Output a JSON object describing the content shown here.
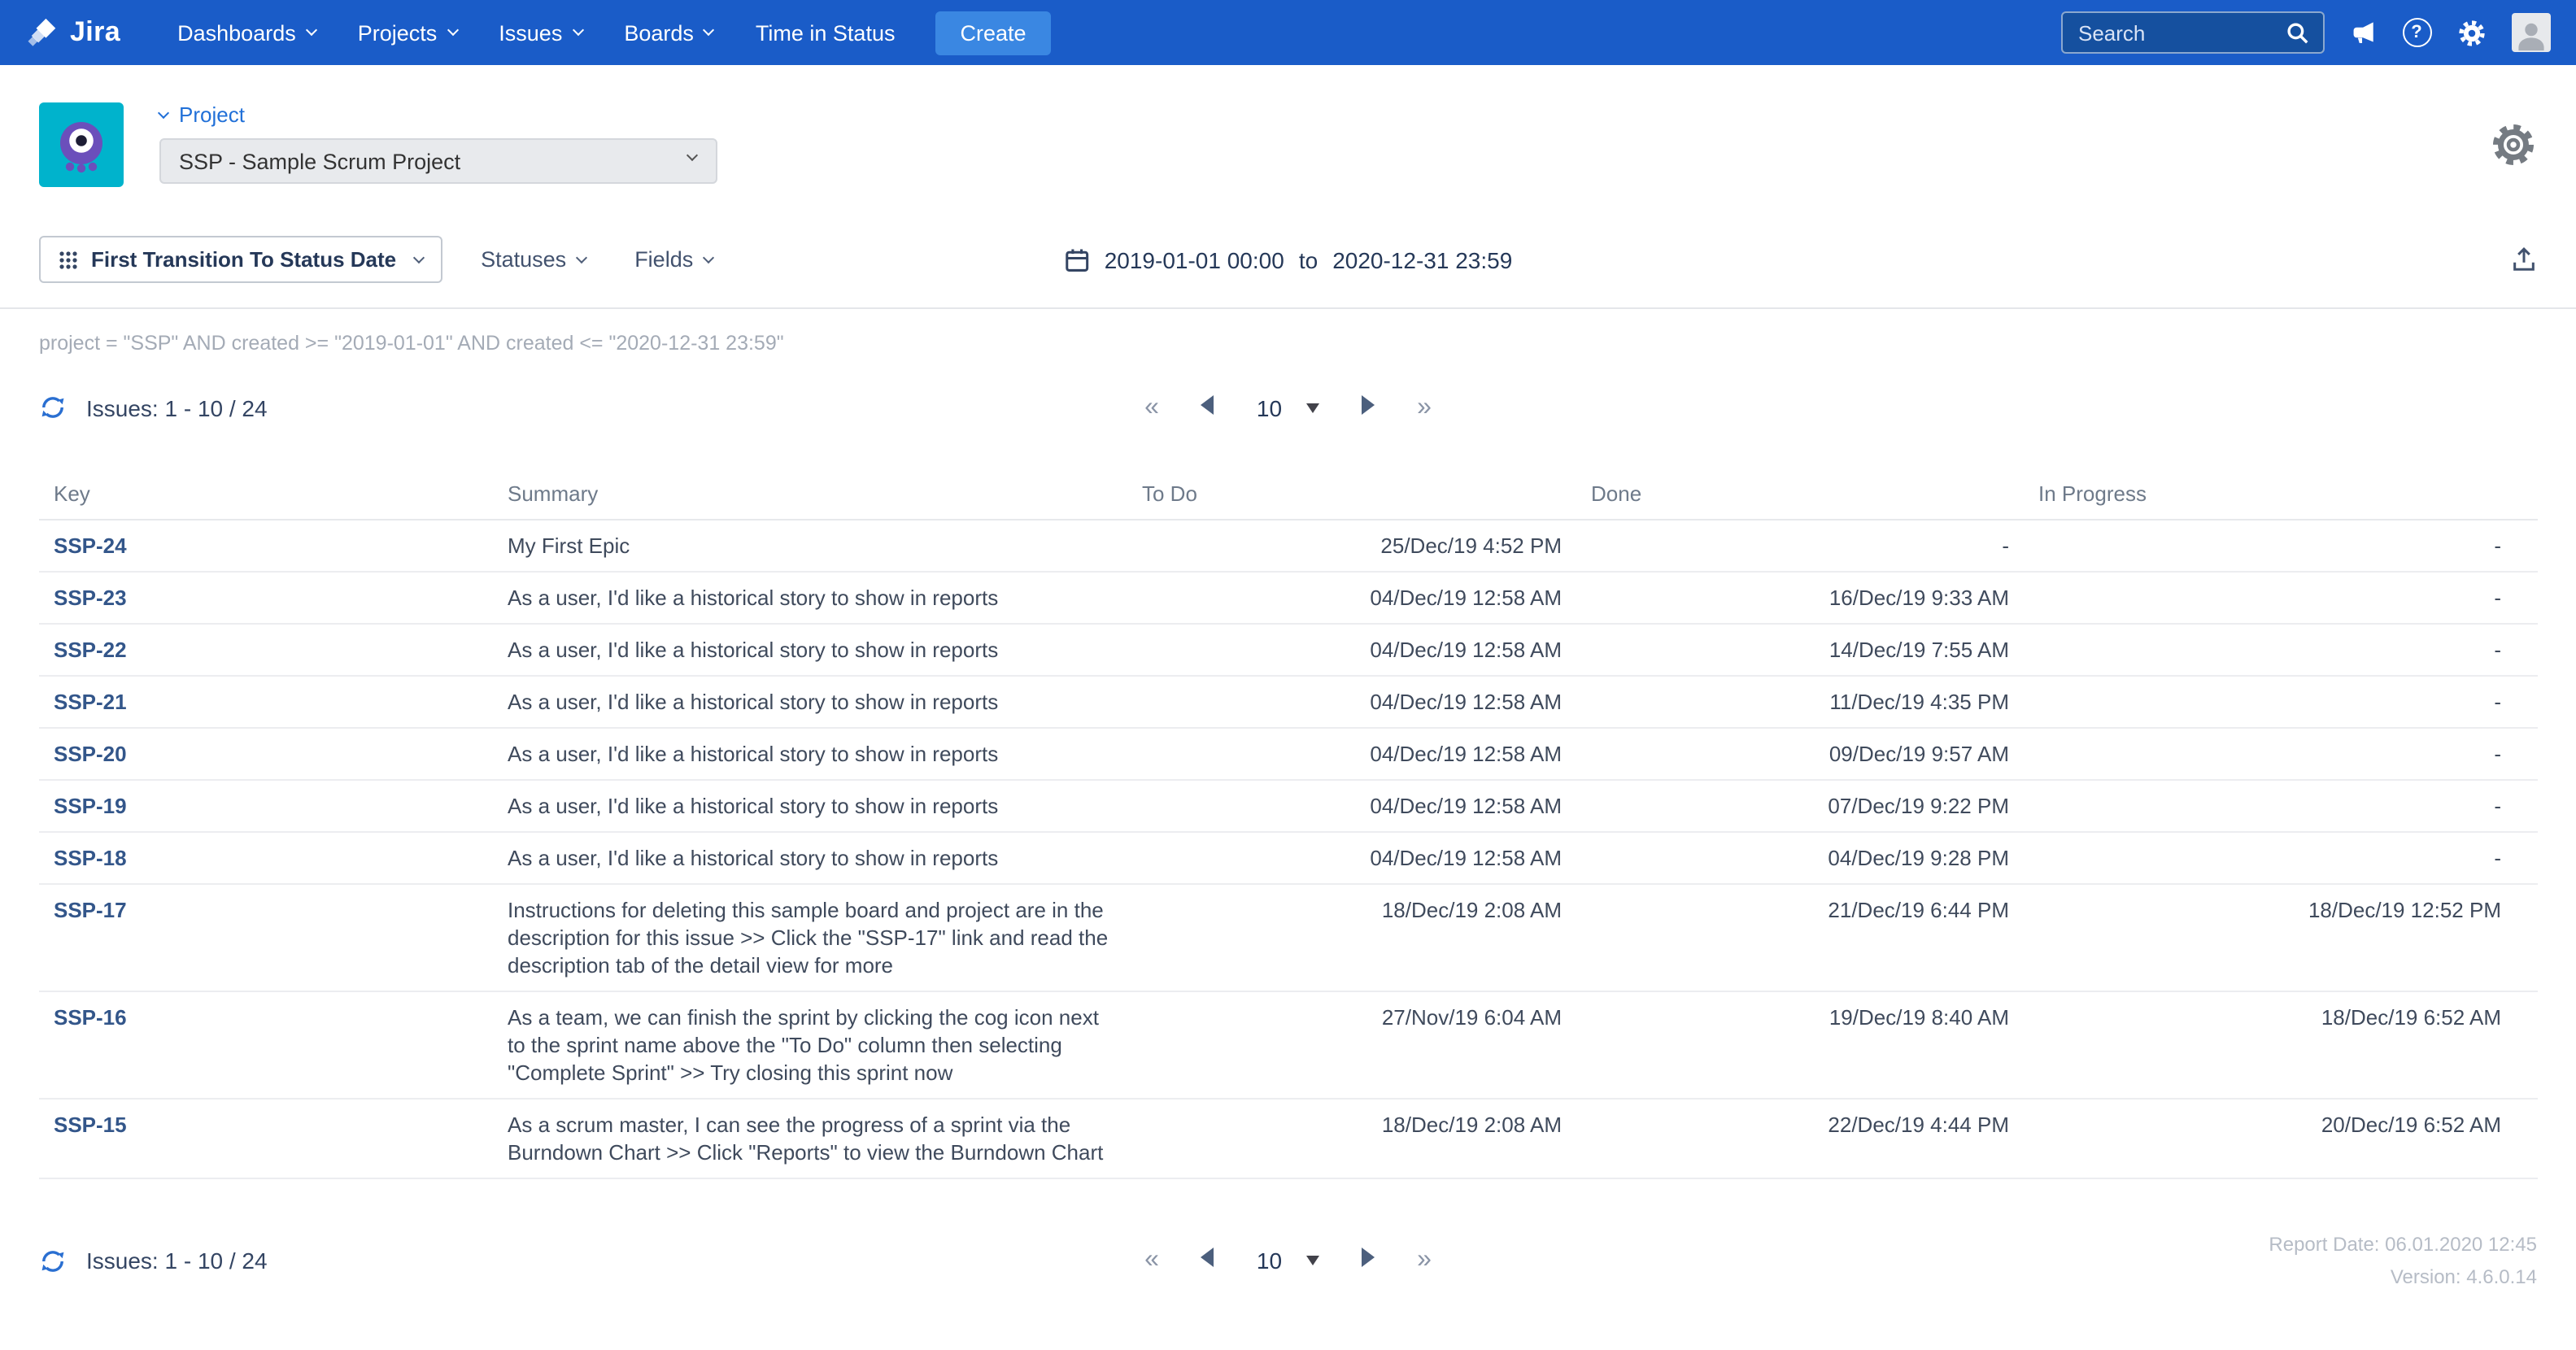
{
  "colors": {
    "nav-bg": "#1a5cc8",
    "create-btn": "#3a87e2",
    "search-bg": "#15509f",
    "link-blue": "#2170d8",
    "key-link": "#33568a",
    "refresh-blue": "#2a6fd1"
  },
  "nav": {
    "brand": "Jira",
    "items": [
      {
        "label": "Dashboards"
      },
      {
        "label": "Projects"
      },
      {
        "label": "Issues"
      },
      {
        "label": "Boards"
      },
      {
        "label": "Time in Status"
      }
    ],
    "create_label": "Create",
    "search_placeholder": "Search"
  },
  "icons": {
    "help_glyph": "?"
  },
  "header": {
    "project_label": "Project",
    "project_select_value": "SSP - Sample Scrum Project"
  },
  "toolbar": {
    "report_type_label": "First Transition To Status Date",
    "statuses_label": "Statuses",
    "fields_label": "Fields",
    "date_from": "2019-01-01 00:00",
    "date_separator": "to",
    "date_to": "2020-12-31 23:59"
  },
  "query_text": "project = \"SSP\" AND created >= \"2019-01-01\" AND created <= \"2020-12-31 23:59\"",
  "issues_label": "Issues: 1 - 10 / 24",
  "pagination": {
    "first": "«",
    "last": "»",
    "page_size": "10"
  },
  "table": {
    "columns": [
      "Key",
      "Summary",
      "To Do",
      "Done",
      "In Progress"
    ],
    "rows": [
      {
        "key": "SSP-24",
        "summary": "My First Epic",
        "todo": "25/Dec/19 4:52 PM",
        "done": "-",
        "inprogress": "-"
      },
      {
        "key": "SSP-23",
        "summary": "As a user, I'd like a historical story to show in reports",
        "todo": "04/Dec/19 12:58 AM",
        "done": "16/Dec/19 9:33 AM",
        "inprogress": "-"
      },
      {
        "key": "SSP-22",
        "summary": "As a user, I'd like a historical story to show in reports",
        "todo": "04/Dec/19 12:58 AM",
        "done": "14/Dec/19 7:55 AM",
        "inprogress": "-"
      },
      {
        "key": "SSP-21",
        "summary": "As a user, I'd like a historical story to show in reports",
        "todo": "04/Dec/19 12:58 AM",
        "done": "11/Dec/19 4:35 PM",
        "inprogress": "-"
      },
      {
        "key": "SSP-20",
        "summary": "As a user, I'd like a historical story to show in reports",
        "todo": "04/Dec/19 12:58 AM",
        "done": "09/Dec/19 9:57 AM",
        "inprogress": "-"
      },
      {
        "key": "SSP-19",
        "summary": "As a user, I'd like a historical story to show in reports",
        "todo": "04/Dec/19 12:58 AM",
        "done": "07/Dec/19 9:22 PM",
        "inprogress": "-"
      },
      {
        "key": "SSP-18",
        "summary": "As a user, I'd like a historical story to show in reports",
        "todo": "04/Dec/19 12:58 AM",
        "done": "04/Dec/19 9:28 PM",
        "inprogress": "-"
      },
      {
        "key": "SSP-17",
        "summary": "Instructions for deleting this sample board and project are in the description for this issue >> Click the \"SSP-17\" link and read the description tab of the detail view for more",
        "todo": "18/Dec/19 2:08 AM",
        "done": "21/Dec/19 6:44 PM",
        "inprogress": "18/Dec/19 12:52 PM"
      },
      {
        "key": "SSP-16",
        "summary": "As a team, we can finish the sprint by clicking the cog icon next to the sprint name above the \"To Do\" column then selecting \"Complete Sprint\" >> Try closing this sprint now",
        "todo": "27/Nov/19 6:04 AM",
        "done": "19/Dec/19 8:40 AM",
        "inprogress": "18/Dec/19 6:52 AM"
      },
      {
        "key": "SSP-15",
        "summary": "As a scrum master, I can see the progress of a sprint via the Burndown Chart >> Click \"Reports\" to view the Burndown Chart",
        "todo": "18/Dec/19 2:08 AM",
        "done": "22/Dec/19 4:44 PM",
        "inprogress": "20/Dec/19 6:52 AM"
      }
    ]
  },
  "footer": {
    "report_date": "Report Date: 06.01.2020 12:45",
    "version": "Version: 4.6.0.14"
  }
}
